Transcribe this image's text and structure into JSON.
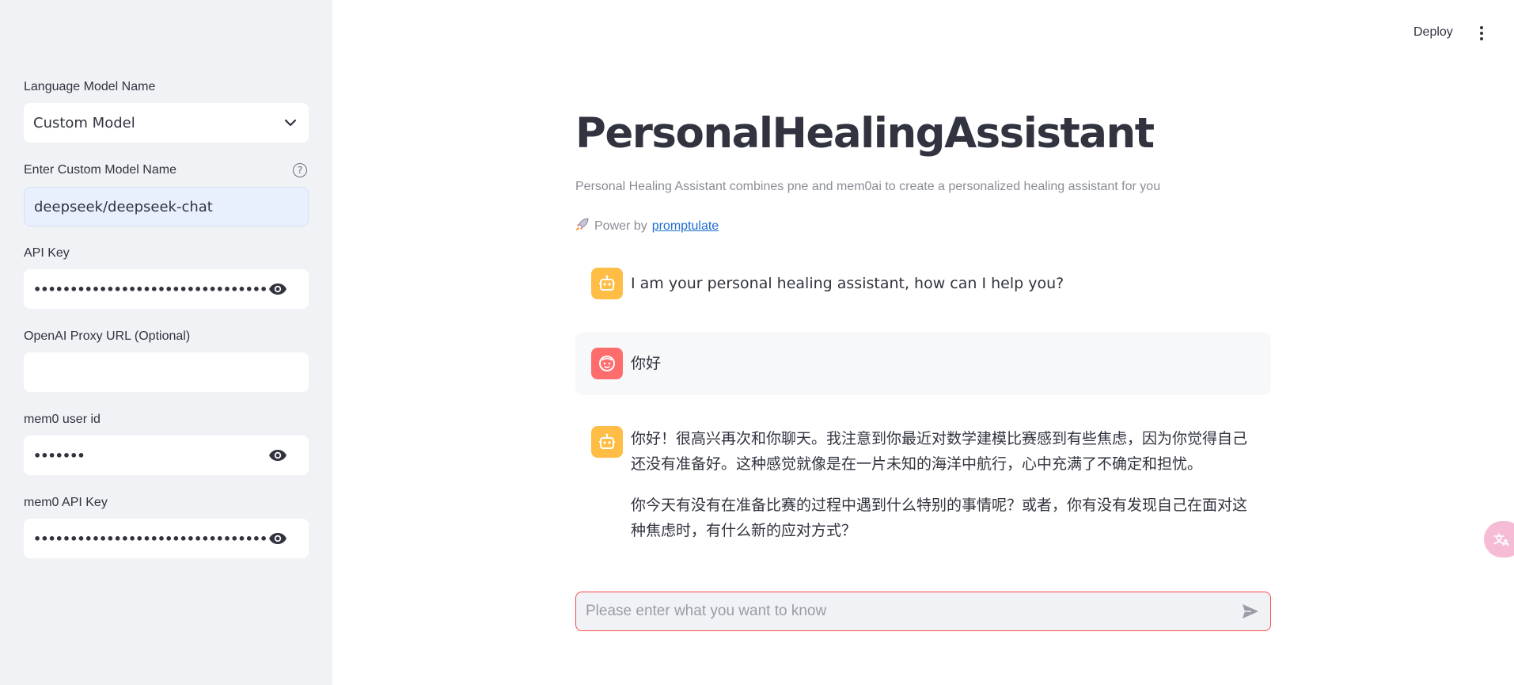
{
  "sidebar": {
    "model_label": "Language Model Name",
    "model_value": "Custom Model",
    "custom_model_label": "Enter Custom Model Name",
    "custom_model_value": "deepseek/deepseek-chat",
    "api_key_label": "API Key",
    "api_key_masked": "••••••••••••••••••••••••••••••••••••",
    "proxy_label": "OpenAI Proxy URL (Optional)",
    "proxy_value": "",
    "mem0_user_label": "mem0 user id",
    "mem0_user_masked": "•••••••",
    "mem0_api_label": "mem0 API Key",
    "mem0_api_masked": "••••••••••••••••••••••••••••••••••••••••••••"
  },
  "header": {
    "deploy_label": "Deploy",
    "menu_icon": "kebab-menu-icon"
  },
  "main": {
    "title": "PersonalHealingAssistant",
    "subtitle": "Personal Healing Assistant combines pne and mem0ai to create a personalized healing assistant for you",
    "power_prefix": "Power by",
    "power_link": "promptulate",
    "messages": [
      {
        "role": "assistant",
        "paragraphs": [
          "I am your personal healing assistant, how can I help you?"
        ]
      },
      {
        "role": "user",
        "paragraphs": [
          "你好"
        ]
      },
      {
        "role": "assistant",
        "paragraphs": [
          "你好！很高兴再次和你聊天。我注意到你最近对数学建模比赛感到有些焦虑，因为你觉得自己还没有准备好。这种感觉就像是在一片未知的海洋中航行，心中充满了不确定和担忧。",
          "你今天有没有在准备比赛的过程中遇到什么特别的事情呢？或者，你有没有发现自己在面对这种焦虑时，有什么新的应对方式？"
        ]
      }
    ],
    "chat_placeholder": "Please enter what you want to know",
    "chat_value": ""
  },
  "colors": {
    "sidebar_bg": "#f0f2f6",
    "bot_avatar": "#ffbd45",
    "user_avatar": "#ff6c6c",
    "input_border": "#ff4b4b",
    "link": "#1f6fd1"
  }
}
